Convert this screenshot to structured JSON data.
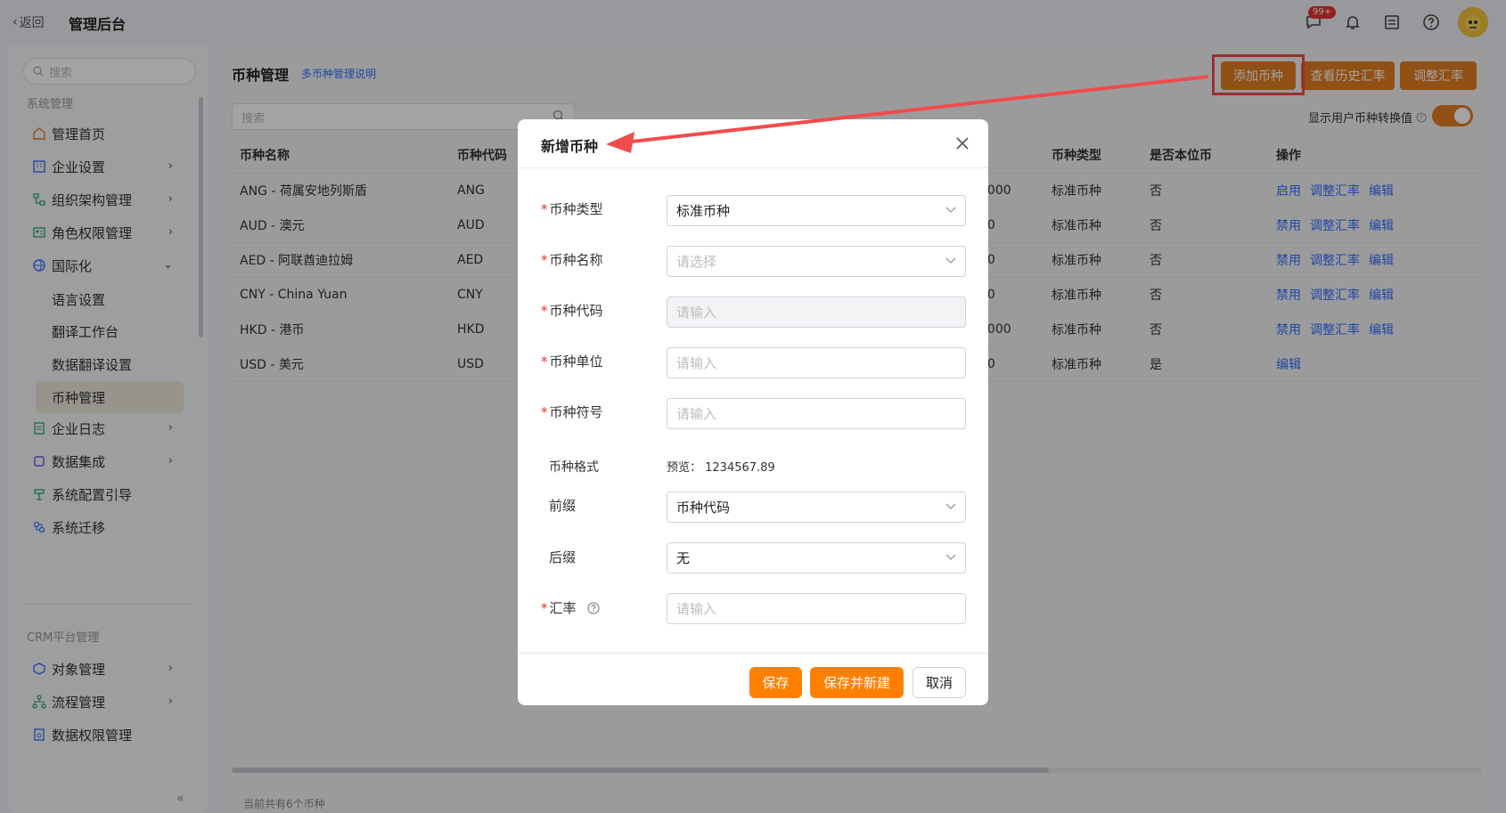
{
  "topbar": {
    "back_label": "返回",
    "title": "管理后台",
    "notify_badge": "99+"
  },
  "sidebar": {
    "search_placeholder": "搜索",
    "group_system": "系统管理",
    "items": [
      {
        "label": "管理首页",
        "icon": "home-icon"
      },
      {
        "label": "企业设置",
        "icon": "building-icon"
      },
      {
        "label": "组织架构管理",
        "icon": "org-icon"
      },
      {
        "label": "角色权限管理",
        "icon": "role-icon"
      },
      {
        "label": "国际化",
        "icon": "globe-icon"
      }
    ],
    "sub_items": [
      "语言设置",
      "翻译工作台",
      "数据翻译设置",
      "币种管理"
    ],
    "items2": [
      {
        "label": "企业日志",
        "icon": "log-icon"
      },
      {
        "label": "数据集成",
        "icon": "integration-icon"
      },
      {
        "label": "系统配置引导",
        "icon": "guide-icon"
      },
      {
        "label": "系统迁移",
        "icon": "migrate-icon"
      }
    ],
    "group_crm": "CRM平台管理",
    "crm_items": [
      {
        "label": "对象管理",
        "icon": "object-icon"
      },
      {
        "label": "流程管理",
        "icon": "flow-icon"
      },
      {
        "label": "数据权限管理",
        "icon": "data-permission-icon"
      }
    ]
  },
  "main": {
    "title": "币种管理",
    "help_link": "多币种管理说明",
    "buttons": {
      "add": "添加币种",
      "history": "查看历史汇率",
      "adjust": "调整汇率"
    },
    "search_placeholder": "搜索",
    "toggle_label": "显示用户币种转换值",
    "table": {
      "headers": [
        "币种名称",
        "币种代码",
        "",
        "币种类型",
        "是否本位币",
        "操作"
      ],
      "rows": [
        {
          "name": "ANG - 荷属安地列斯盾",
          "code": "ANG",
          "rate": "0000",
          "type": "标准币种",
          "base": "否",
          "actions": [
            "启用",
            "调整汇率",
            "编辑"
          ]
        },
        {
          "name": "AUD - 澳元",
          "code": "AUD",
          "rate": "00",
          "type": "标准币种",
          "base": "否",
          "actions": [
            "禁用",
            "调整汇率",
            "编辑"
          ]
        },
        {
          "name": "AED - 阿联酋迪拉姆",
          "code": "AED",
          "rate": "00",
          "type": "标准币种",
          "base": "否",
          "actions": [
            "禁用",
            "调整汇率",
            "编辑"
          ]
        },
        {
          "name": "CNY - China Yuan",
          "code": "CNY",
          "rate": "00",
          "type": "标准币种",
          "base": "否",
          "actions": [
            "禁用",
            "调整汇率",
            "编辑"
          ]
        },
        {
          "name": "HKD - 港币",
          "code": "HKD",
          "rate": "0000",
          "type": "标准币种",
          "base": "否",
          "actions": [
            "禁用",
            "调整汇率",
            "编辑"
          ]
        },
        {
          "name": "USD - 美元",
          "code": "USD",
          "rate": "00",
          "type": "标准币种",
          "base": "是",
          "actions": [
            "编辑"
          ]
        }
      ]
    },
    "footer": "当前共有6个币种"
  },
  "modal": {
    "title": "新增币种",
    "fields": {
      "type": {
        "label": "币种类型",
        "value": "标准币种"
      },
      "name": {
        "label": "币种名称",
        "placeholder": "请选择"
      },
      "code": {
        "label": "币种代码",
        "placeholder": "请输入"
      },
      "unit": {
        "label": "币种单位",
        "placeholder": "请输入"
      },
      "symbol": {
        "label": "币种符号",
        "placeholder": "请输入"
      },
      "format": {
        "label": "币种格式",
        "preview": "预览：   1234567.89"
      },
      "prefix": {
        "label": "前缀",
        "value": "币种代码"
      },
      "suffix": {
        "label": "后缀",
        "value": "无"
      },
      "rate": {
        "label": "汇率",
        "placeholder": "请输入"
      }
    },
    "buttons": {
      "save": "保存",
      "save_new": "保存并新建",
      "cancel": "取消"
    }
  },
  "colors": {
    "accent": "#e37d22",
    "primary_button": "#ff8000",
    "link": "#3370ff",
    "highlight": "#f24b4b"
  }
}
